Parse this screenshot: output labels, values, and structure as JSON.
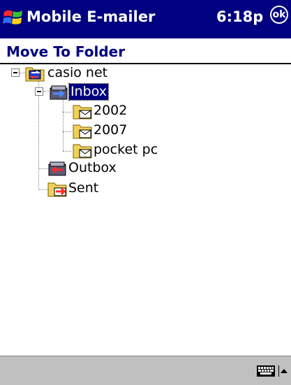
{
  "titlebar": {
    "app_title": "Mobile E-mailer",
    "time": "6:18p",
    "ok_label": "ok"
  },
  "page": {
    "title": "Move To Folder"
  },
  "tree": {
    "root": "casio net",
    "inbox": "Inbox",
    "inbox_children": [
      "2002",
      "2007",
      "pocket pc"
    ],
    "outbox": "Outbox",
    "sent": "Sent"
  },
  "taskbar": {
    "keyboard_icon": "keyboard-icon",
    "sip_icon": "arrow-up-icon"
  },
  "colors": {
    "titlebar_bg": "#000080",
    "title_text": "#000080",
    "taskbar_bg": "#c0c0c0",
    "selection_bg": "#000080"
  }
}
